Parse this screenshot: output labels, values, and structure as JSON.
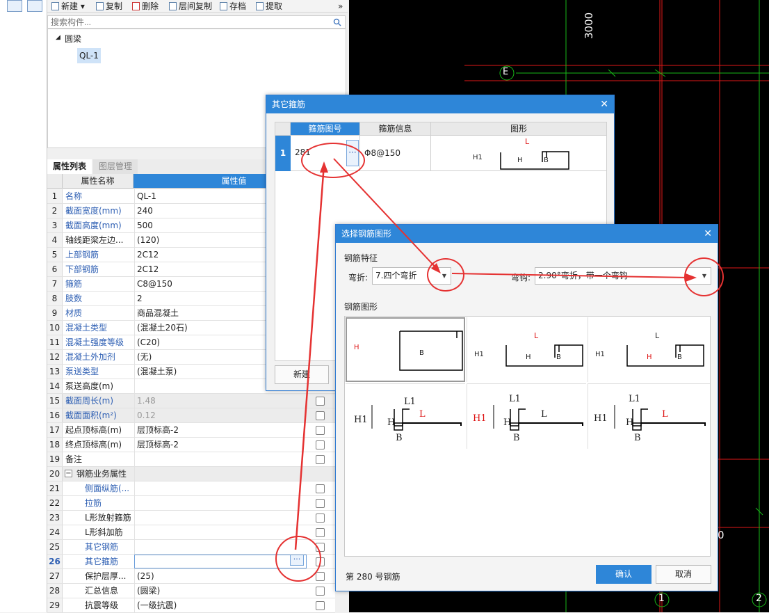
{
  "toolbar": {
    "new_label": "新建",
    "copy_label": "复制",
    "delete_label": "删除",
    "floor_copy_label": "层间复制",
    "archive_label": "存档",
    "extract_label": "提取",
    "more_label": "»"
  },
  "search": {
    "placeholder": "搜索构件..."
  },
  "tree": {
    "category": "圆梁",
    "item": "QL-1"
  },
  "cad": {
    "dimension_label": "3000",
    "axis_e": "E",
    "axis_1": "1",
    "axis_2": "2",
    "partial_label": "0"
  },
  "props": {
    "tabs": [
      "属性列表",
      "图层管理"
    ],
    "col_name": "属性名称",
    "col_value": "属性值",
    "rows": [
      {
        "n": "1",
        "k": "名称",
        "v": "QL-1",
        "blue": true
      },
      {
        "n": "2",
        "k": "截面宽度(mm)",
        "v": "240",
        "blue": true
      },
      {
        "n": "3",
        "k": "截面高度(mm)",
        "v": "500",
        "blue": true
      },
      {
        "n": "4",
        "k": "轴线距梁左边...",
        "v": "(120)",
        "blue": false
      },
      {
        "n": "5",
        "k": "上部钢筋",
        "v": "2C12",
        "blue": true
      },
      {
        "n": "6",
        "k": "下部钢筋",
        "v": "2C12",
        "blue": true
      },
      {
        "n": "7",
        "k": "箍筋",
        "v": "C8@150",
        "blue": true
      },
      {
        "n": "8",
        "k": "肢数",
        "v": "2",
        "blue": true
      },
      {
        "n": "9",
        "k": "材质",
        "v": "商品混凝土",
        "blue": true
      },
      {
        "n": "10",
        "k": "混凝土类型",
        "v": "(混凝土20石)",
        "blue": true
      },
      {
        "n": "11",
        "k": "混凝土强度等级",
        "v": "(C20)",
        "blue": true
      },
      {
        "n": "12",
        "k": "混凝土外加剂",
        "v": "(无)",
        "blue": true
      },
      {
        "n": "13",
        "k": "泵送类型",
        "v": "(混凝土泵)",
        "blue": true
      },
      {
        "n": "14",
        "k": "泵送高度(m)",
        "v": "",
        "blue": false
      },
      {
        "n": "15",
        "k": "截面周长(m)",
        "v": "1.48",
        "blue": true
      },
      {
        "n": "16",
        "k": "截面面积(m²)",
        "v": "0.12",
        "blue": true
      },
      {
        "n": "17",
        "k": "起点顶标高(m)",
        "v": "层顶标高-2",
        "blue": false
      },
      {
        "n": "18",
        "k": "终点顶标高(m)",
        "v": "层顶标高-2",
        "blue": false
      },
      {
        "n": "19",
        "k": "备注",
        "v": "",
        "blue": false
      },
      {
        "n": "20",
        "k": "钢筋业务属性",
        "v": "",
        "blue": false
      },
      {
        "n": "21",
        "k": "侧面纵筋(...",
        "v": "",
        "blue": true
      },
      {
        "n": "22",
        "k": "拉筋",
        "v": "",
        "blue": true
      },
      {
        "n": "23",
        "k": "L形放射箍筋",
        "v": "",
        "blue": false
      },
      {
        "n": "24",
        "k": "L形斜加筋",
        "v": "",
        "blue": false
      },
      {
        "n": "25",
        "k": "其它钢筋",
        "v": "",
        "blue": true
      },
      {
        "n": "26",
        "k": "其它箍筋",
        "v": "",
        "blue": true
      },
      {
        "n": "27",
        "k": "保护层厚...",
        "v": "(25)",
        "blue": false
      },
      {
        "n": "28",
        "k": "汇总信息",
        "v": "(圆梁)",
        "blue": false
      },
      {
        "n": "29",
        "k": "抗震等级",
        "v": "(一级抗震)",
        "blue": false
      }
    ]
  },
  "stirrup_dialog": {
    "title": "其它箍筋",
    "col_shape_no": "箍筋图号",
    "col_info": "箍筋信息",
    "col_figure": "图形",
    "row_no": "1",
    "shape_no": "281",
    "info": "Φ8@150",
    "fig_L": "L",
    "fig_H1": "H1",
    "fig_H": "H",
    "fig_B": "B",
    "new_button": "新建"
  },
  "select_dialog": {
    "title": "选择钢筋图形",
    "feature_label": "钢筋特征",
    "bend_label": "弯折:",
    "bend_value": "7.四个弯折",
    "hook_label": "弯钩:",
    "hook_value": "2.90°弯折，带一个弯钩",
    "shape_label": "钢筋图形",
    "status": "第 280 号钢筋",
    "confirm": "确认",
    "cancel": "取消",
    "shapes": [
      {
        "H": "H",
        "B": "B"
      },
      {
        "L": "L",
        "H1": "H1",
        "H": "H",
        "B": "B"
      },
      {
        "L": "L",
        "H1": "H1",
        "H": "H",
        "B": "B"
      },
      {
        "L1": "L1",
        "H1": "H1",
        "H": "H",
        "L": "L",
        "B": "B"
      },
      {
        "L1": "L1",
        "H1": "H1",
        "H": "H",
        "L": "L",
        "B": "B"
      },
      {
        "L1": "L1",
        "H1": "H1",
        "H": "H",
        "L": "L",
        "B": "B"
      }
    ]
  },
  "colors": {
    "accent": "#2e86d8",
    "annotation_red": "#e53232",
    "cad_bg": "#000000",
    "cad_grid_red": "#e01818",
    "cad_grid_green": "#18b818"
  }
}
